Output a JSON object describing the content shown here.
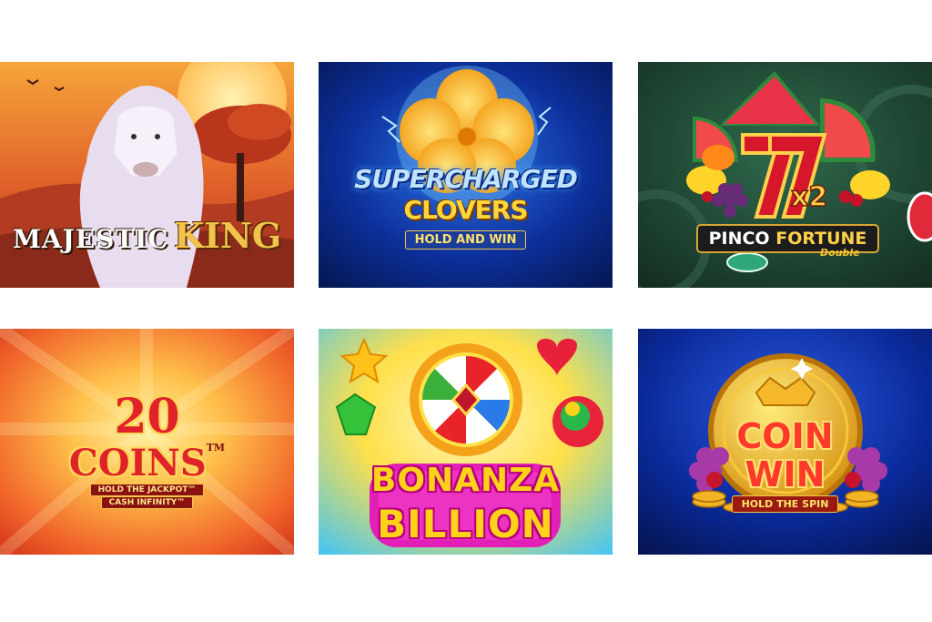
{
  "games": [
    {
      "id": "majestic-king",
      "title_part1": "MAJESTIC",
      "title_part2": "KING"
    },
    {
      "id": "supercharged-clovers",
      "line1": "SUPERCHARGED",
      "line2": "CLOVERS",
      "tagline": "HOLD AND WIN"
    },
    {
      "id": "pinco-fortune",
      "multiplier": "x2",
      "name_part1": "PINCO",
      "name_part2": "FORTUNE",
      "subtitle": "Double"
    },
    {
      "id": "20-coins",
      "number": "20",
      "word": "COINS",
      "trademark": "TM",
      "tagline1": "HOLD THE JACKPOT™",
      "tagline2": "CASH INFINITY™"
    },
    {
      "id": "bonanza-billion",
      "line1": "BONANZA",
      "line2": "BILLION"
    },
    {
      "id": "coin-win",
      "line1": "COIN",
      "line2": "WIN",
      "tagline": "HOLD THE SPIN"
    }
  ],
  "colors": {
    "background": "#ffffff",
    "majestic_gold": "#f2c34a",
    "clovers_blue": "#0b2a8a",
    "pinco_green": "#1f4a35",
    "coins_red": "#e0222a",
    "bonanza_pink": "#e21fb6",
    "coinwin_navy": "#0a1f8a"
  }
}
